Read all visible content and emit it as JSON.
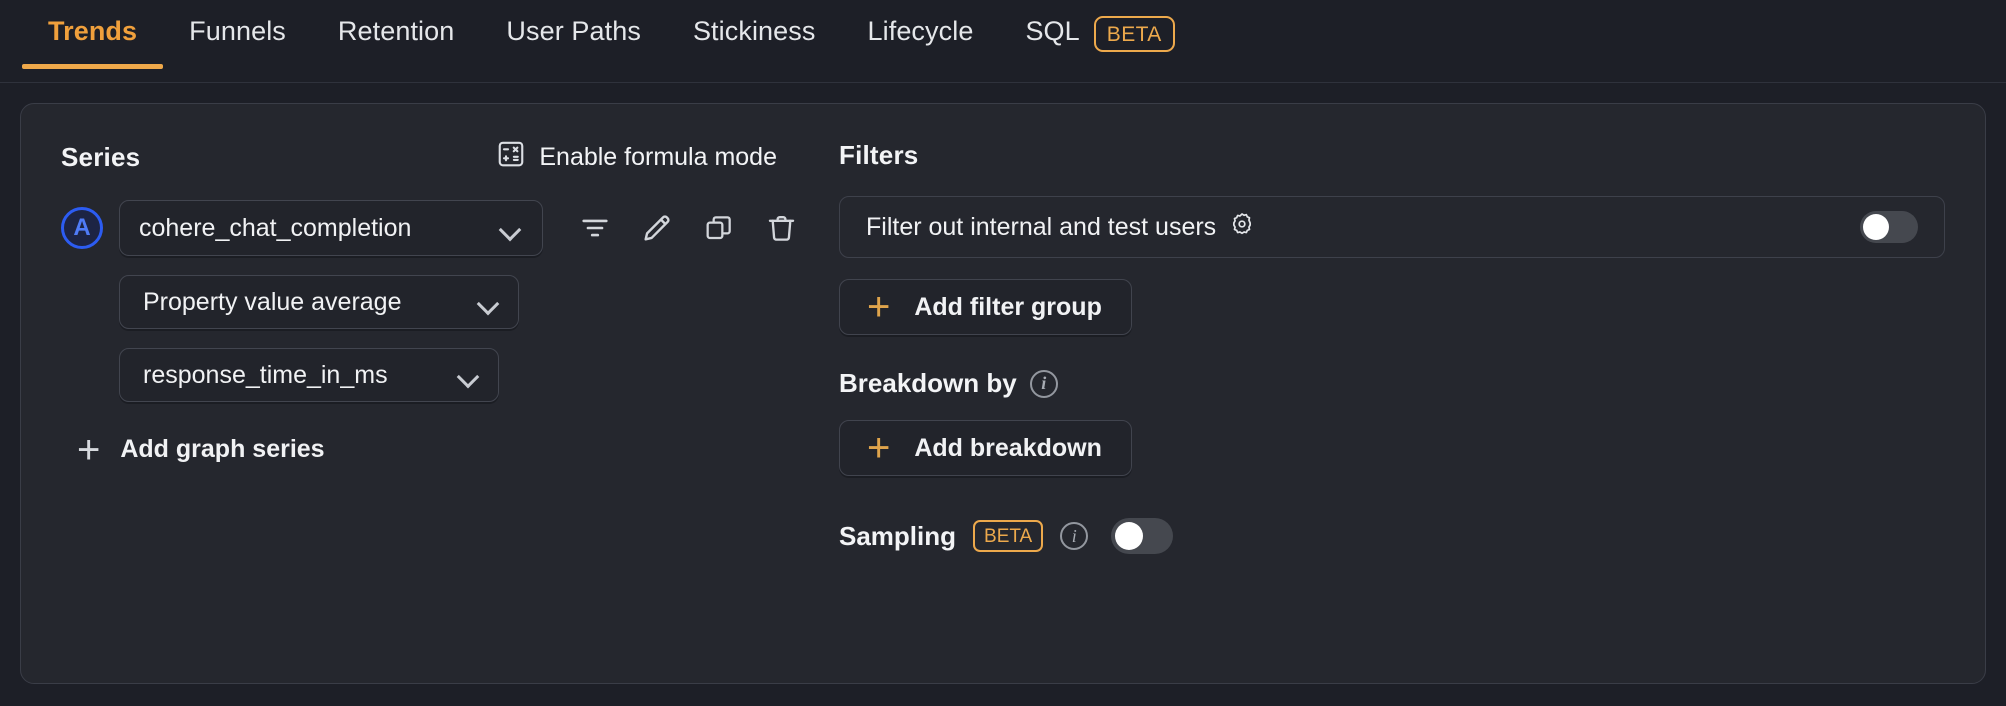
{
  "tabs": [
    {
      "label": "Trends",
      "active": true,
      "badge": null
    },
    {
      "label": "Funnels",
      "active": false,
      "badge": null
    },
    {
      "label": "Retention",
      "active": false,
      "badge": null
    },
    {
      "label": "User Paths",
      "active": false,
      "badge": null
    },
    {
      "label": "Stickiness",
      "active": false,
      "badge": null
    },
    {
      "label": "Lifecycle",
      "active": false,
      "badge": null
    },
    {
      "label": "SQL",
      "active": false,
      "badge": "BETA"
    }
  ],
  "series": {
    "title": "Series",
    "formula_mode_label": "Enable formula mode",
    "formula_mode_icon": "calculator-icon",
    "letter": "A",
    "event_value": "cohere_chat_completion",
    "math_value": "Property value average",
    "property_value": "response_time_in_ms",
    "actions": [
      {
        "name": "filter-icon",
        "title": "Filter"
      },
      {
        "name": "edit-icon",
        "title": "Edit"
      },
      {
        "name": "duplicate-icon",
        "title": "Duplicate"
      },
      {
        "name": "delete-icon",
        "title": "Delete"
      }
    ],
    "add_series_label": "Add graph series"
  },
  "filters": {
    "title": "Filters",
    "internal_users_label": "Filter out internal and test users",
    "internal_users_gear_icon": "gear-icon",
    "internal_users_enabled": false,
    "add_filter_group_label": "Add filter group"
  },
  "breakdown": {
    "title": "Breakdown by",
    "info_icon": "info-icon",
    "add_breakdown_label": "Add breakdown"
  },
  "sampling": {
    "label": "Sampling",
    "badge": "BETA",
    "info_icon": "info-icon",
    "enabled": false
  },
  "colors": {
    "page_bg": "#1d1f27",
    "card_bg": "#25272e",
    "accent_amber": "#efa84a",
    "series_blue": "#2c5cf2",
    "text_primary": "#f1f2f4"
  }
}
